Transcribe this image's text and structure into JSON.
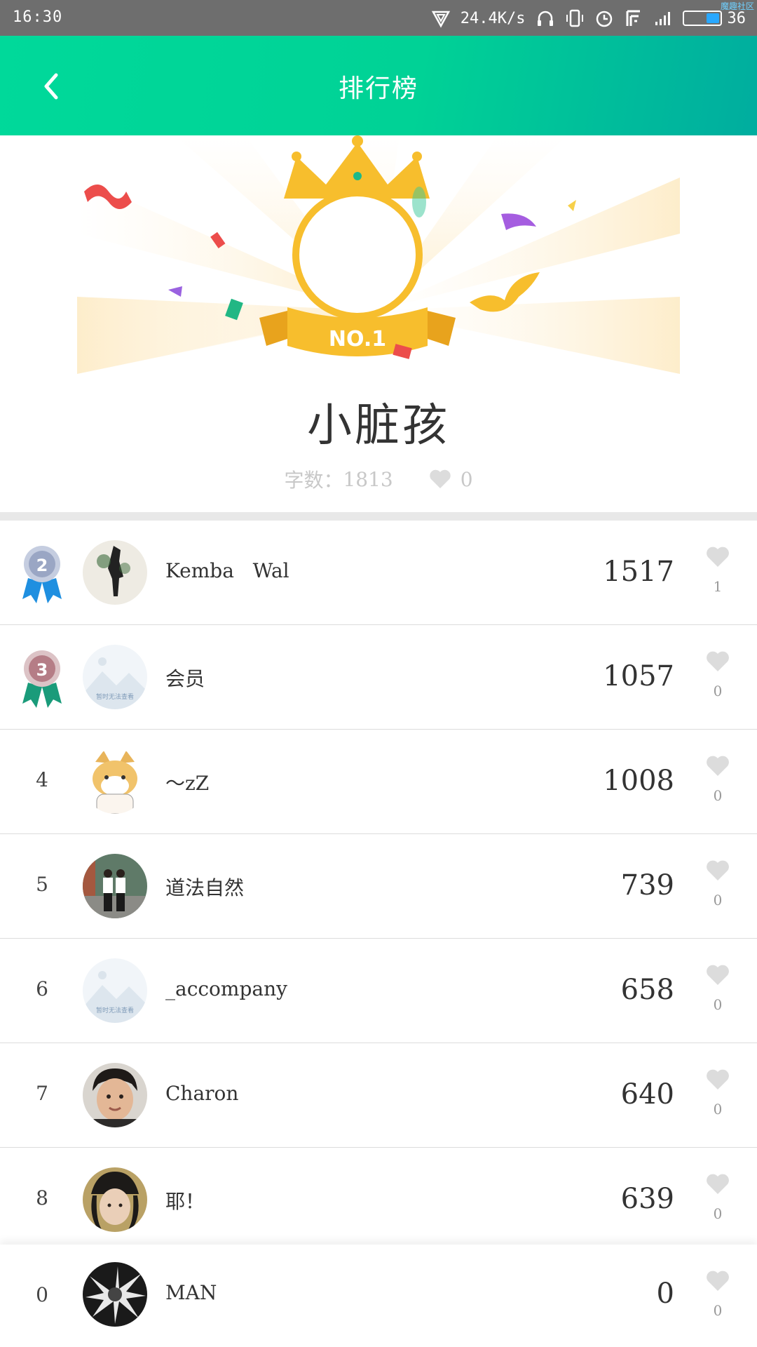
{
  "status_bar": {
    "time": "16:30",
    "net_speed": "24.4K/s",
    "battery": "36",
    "corner_text": "魔趣社区"
  },
  "header": {
    "title": "排行榜",
    "back_icon": "chevron-left-icon"
  },
  "top_user": {
    "badge_text": "NO.1",
    "name": "小脏孩",
    "word_count_label": "字数：",
    "word_count": "1813",
    "likes": "0"
  },
  "ranking": [
    {
      "rank": "2",
      "medal": "silver",
      "name": "Kemba   Wal",
      "score": "1517",
      "likes": "1",
      "avatar": "photo-dark-figure"
    },
    {
      "rank": "3",
      "medal": "bronze",
      "name": "会员",
      "score": "1057",
      "likes": "0",
      "avatar": "placeholder",
      "avatar_caption": "暂时无法查看"
    },
    {
      "rank": "4",
      "medal": "",
      "name": "～zZ",
      "score": "1008",
      "likes": "0",
      "avatar": "doge-cartoon"
    },
    {
      "rank": "5",
      "medal": "",
      "name": "道法自然",
      "score": "739",
      "likes": "0",
      "avatar": "photo-two-people"
    },
    {
      "rank": "6",
      "medal": "",
      "name": "_accompany",
      "score": "658",
      "likes": "0",
      "avatar": "placeholder",
      "avatar_caption": "暂时无法查看"
    },
    {
      "rank": "7",
      "medal": "",
      "name": "Charon",
      "score": "640",
      "likes": "0",
      "avatar": "photo-boy"
    },
    {
      "rank": "8",
      "medal": "",
      "name": "耶！",
      "score": "639",
      "likes": "0",
      "avatar": "photo-girl-hat"
    }
  ],
  "current_user": {
    "rank": "0",
    "name": "MAN",
    "score": "0",
    "likes": "0",
    "avatar": "photo-dark-splash"
  },
  "colors": {
    "header_start": "#00d99a",
    "header_end": "#00ad9f",
    "gold": "#f7be2d",
    "silver": "#9aa6c4",
    "bronze": "#b57d86",
    "ribbon_blue": "#1f8fe0",
    "ribbon_green": "#1a9b7a"
  }
}
